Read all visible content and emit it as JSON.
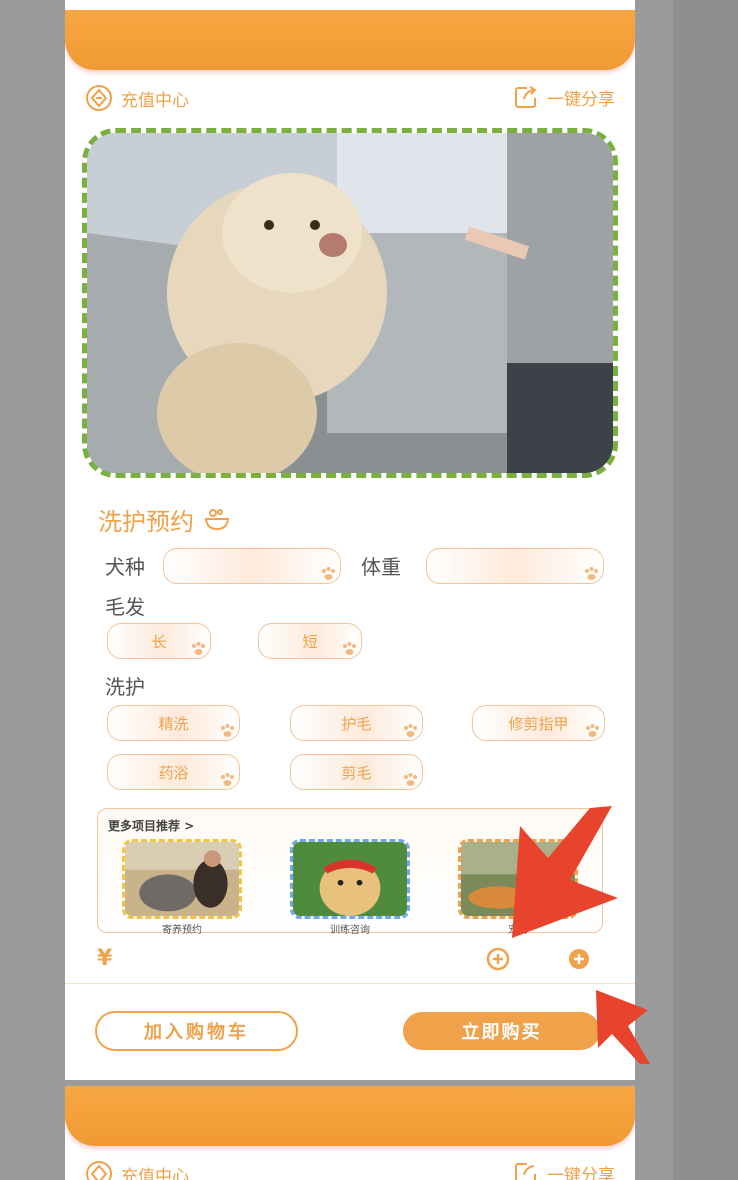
{
  "header": {
    "recharge_label": "充值中心",
    "share_label": "一键分享"
  },
  "booking": {
    "title": "洗护预约",
    "breed_label": "犬种",
    "weight_label": "体重",
    "fur_label": "毛发",
    "fur_options": [
      "长",
      "短"
    ],
    "care_label": "洗护",
    "care_options": [
      "精洗",
      "护毛",
      "修剪指甲",
      "药浴",
      "剪毛"
    ]
  },
  "recommend": {
    "title": "更多项目推荐 >",
    "items": [
      {
        "caption": "寄养预约"
      },
      {
        "caption": "训练咨询"
      },
      {
        "caption": "宠物"
      }
    ]
  },
  "footer": {
    "currency": "¥",
    "add_cart_label": "加入购物车",
    "buy_now_label": "立即购买"
  },
  "next_card": {
    "recharge_label": "充值中心",
    "share_label": "一键分享"
  },
  "colors": {
    "accent": "#f0a24a",
    "banner": "#f19a34",
    "annotation_arrow": "#e8432c"
  },
  "icons": [
    "coin-icon",
    "share-icon",
    "bath-icon",
    "paw-icon",
    "plus-circle-icon",
    "arrow-annotation"
  ]
}
